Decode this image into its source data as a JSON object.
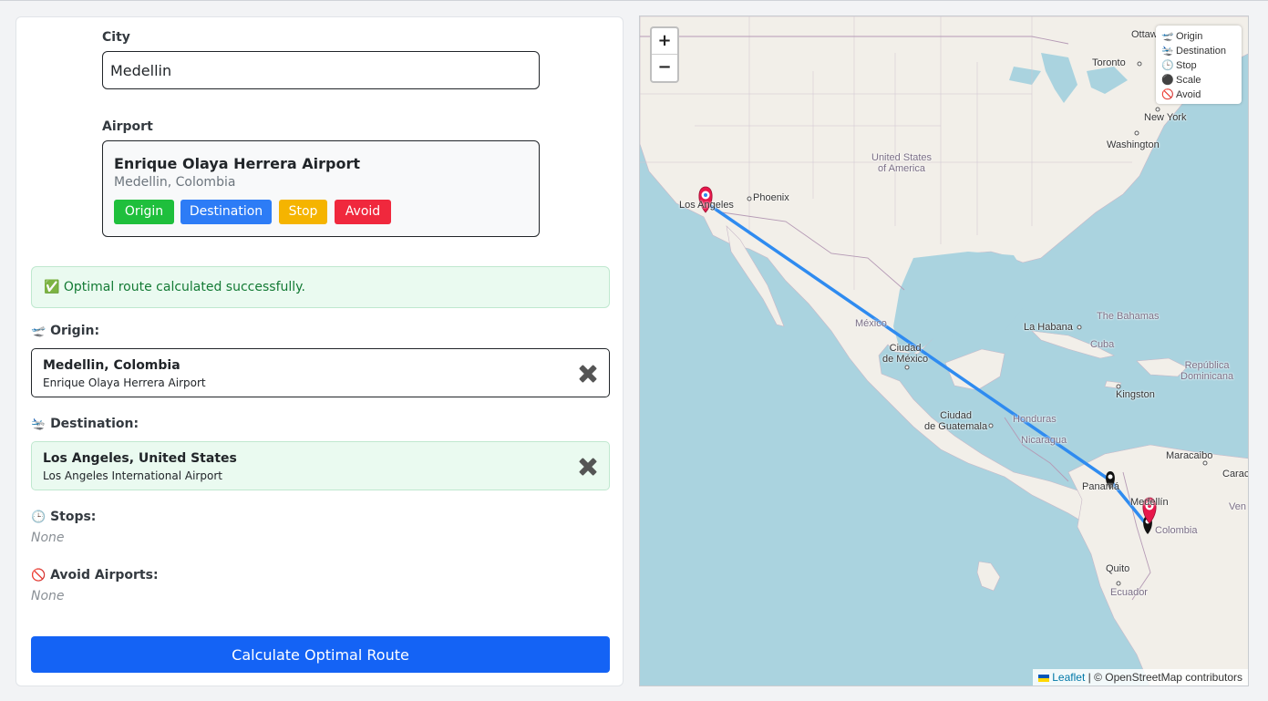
{
  "form": {
    "city_label": "City",
    "city_value": "Medellin",
    "airport_label": "Airport"
  },
  "airport_card": {
    "name": "Enrique Olaya Herrera Airport",
    "location": "Medellin, Colombia",
    "buttons": {
      "origin": "Origin",
      "destination": "Destination",
      "stop": "Stop",
      "avoid": "Avoid"
    },
    "colors": {
      "origin": "#1fbf3c",
      "destination": "#2d7cf6",
      "stop": "#f5b400",
      "avoid": "#f0283d"
    }
  },
  "alert": {
    "text": "✅ Optimal route calculated successfully."
  },
  "origin": {
    "label": "Origin:",
    "icon": "airplane-takeoff-icon",
    "title": "Medellin, Colombia",
    "subtitle": "Enrique Olaya Herrera Airport"
  },
  "destination": {
    "label": "Destination:",
    "icon": "airplane-landing-icon",
    "title": "Los Angeles, United States",
    "subtitle": "Los Angeles International Airport"
  },
  "stops": {
    "label": "Stops:",
    "icon": "clock-icon",
    "value": "None"
  },
  "avoid": {
    "label": "Avoid Airports:",
    "icon": "no-entry-icon",
    "value": "None"
  },
  "calculate_button": "Calculate Optimal Route",
  "map": {
    "zoom_in": "+",
    "zoom_out": "−",
    "legend": [
      {
        "icon": "airplane-takeoff-icon",
        "label": "Origin"
      },
      {
        "icon": "airplane-landing-icon",
        "label": "Destination"
      },
      {
        "icon": "clock-icon",
        "label": "Stop"
      },
      {
        "icon": "black-circle-icon",
        "label": "Scale"
      },
      {
        "icon": "no-entry-icon",
        "label": "Avoid"
      }
    ],
    "attribution_link": "Leaflet",
    "attribution_text": "| © OpenStreetMap contributors",
    "route_color": "#2f8bf0",
    "labels": {
      "ottawa": "Ottaw",
      "toronto": "Toronto",
      "new_york": "New York",
      "washington": "Washington",
      "usa_1": "United States",
      "usa_2": "of America",
      "phoenix": "Phoenix",
      "los_angeles": "Los Angeles",
      "mexico": "México",
      "mexico_city_1": "Ciudad",
      "mexico_city_2": "de México",
      "la_habana": "La Habana",
      "bahamas": "The Bahamas",
      "cuba": "Cuba",
      "dominicana_1": "República",
      "dominicana_2": "Dominicana",
      "kingston": "Kingston",
      "honduras": "Honduras",
      "guatemala_1": "Ciudad",
      "guatemala_2": "de Guatemala",
      "nicaragua": "Nicaragua",
      "maracaibo": "Maracaibo",
      "caracas": "Carac",
      "venezuela": "Ven",
      "panama": "Panamá",
      "medellin": "Medellín",
      "colombia": "Colombia",
      "quito": "Quito",
      "ecuador": "Ecuador"
    }
  }
}
